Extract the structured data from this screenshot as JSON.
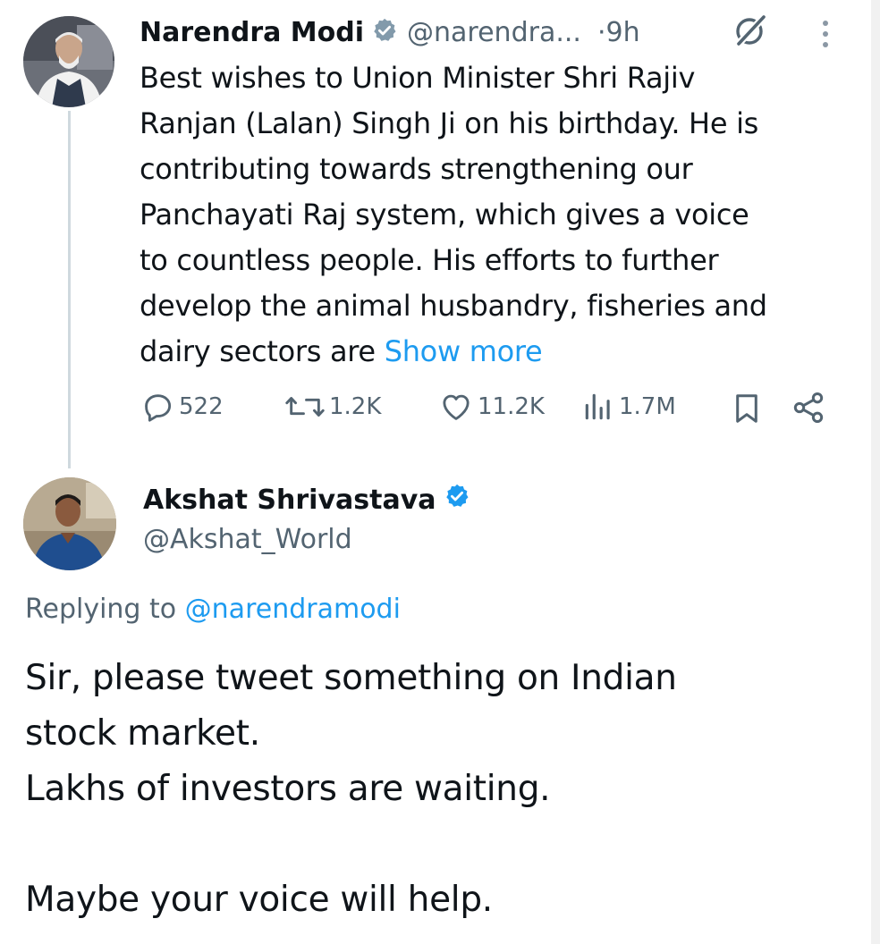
{
  "tweet": {
    "author_name": "Narendra Modi",
    "author_handle": "@narendra...",
    "time": "·9h",
    "text_lines": [
      "Best wishes to Union Minister Shri Rajiv",
      "Ranjan (Lalan) Singh Ji on his birthday. He is",
      "contributing towards strengthening our",
      "Panchayati Raj system, which gives a voice",
      "to countless people. His efforts to further",
      "develop the animal husbandry, fisheries and",
      "dairy sectors are "
    ],
    "show_more": "Show more",
    "stats": {
      "replies": "522",
      "reposts": "1.2K",
      "likes": "11.2K",
      "views": "1.7M"
    }
  },
  "reply": {
    "author_name": "Akshat Shrivastava",
    "author_handle": "@Akshat_World",
    "replying_prefix": "Replying to ",
    "replying_mention": "@narendramodi",
    "text_lines": [
      "Sir, please tweet something on Indian",
      "stock market.",
      "Lakhs of investors are waiting.",
      "",
      "Maybe your voice will help."
    ]
  },
  "icons": {
    "verified": "verified-badge-icon",
    "grok": "grok-icon",
    "more": "more-vertical-icon",
    "reply": "reply-icon",
    "repost": "repost-icon",
    "like": "like-icon",
    "views": "views-icon",
    "bookmark": "bookmark-icon",
    "share": "share-icon"
  },
  "colors": {
    "accent": "#1d9bf0",
    "secondary_text": "#536471",
    "primary_text": "#0f1419"
  }
}
